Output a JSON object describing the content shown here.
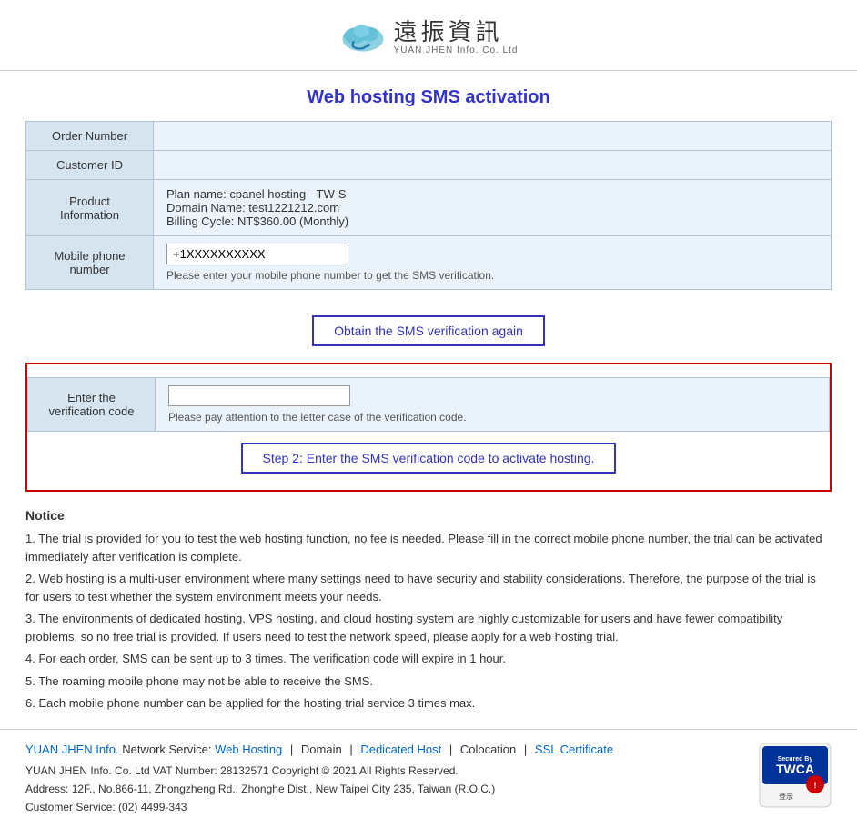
{
  "header": {
    "logo_chinese": "遠振資訊",
    "logo_english": "YUAN JHEN Info. Co. Ltd"
  },
  "page_title": "Web hosting SMS activation",
  "form": {
    "order_number_label": "Order Number",
    "customer_id_label": "Customer ID",
    "product_info_label": "Product Information",
    "product_info_line1": "Plan name: cpanel hosting - TW-S",
    "product_info_line2": "Domain Name: test1221212.com",
    "product_info_line3": "Billing Cycle: NT$360.00 (Monthly)",
    "mobile_label": "Mobile phone number",
    "mobile_value": "+1XXXXXXXXXX",
    "mobile_hint": "Please enter your mobile phone number to get the SMS verification.",
    "sms_button": "Obtain the SMS verification again",
    "verify_label": "Enter the verification code",
    "verify_placeholder": "",
    "verify_hint": "Please pay attention to the letter case of the verification code.",
    "step2_button": "Step 2: Enter the SMS verification code to activate hosting."
  },
  "notice": {
    "title": "Notice",
    "items": [
      "The trial is provided for you to test the web hosting function, no fee is needed. Please fill in the correct mobile phone number, the trial can be activated immediately after verification is complete.",
      "Web hosting is a multi-user environment where many settings need to have security and stability considerations. Therefore, the purpose of the trial is for users to test whether the system environment meets your needs.",
      "The environments of dedicated hosting, VPS hosting, and cloud hosting system are highly customizable for users and have fewer compatibility problems, so no free trial is provided. If users need to test the network speed, please apply for a web hosting trial.",
      "For each order, SMS can be sent up to 3 times. The verification code will expire in 1 hour.",
      "The roaming mobile phone may not be able to receive the SMS.",
      "Each mobile phone number can be applied for the hosting trial service 3 times max."
    ]
  },
  "footer": {
    "brand": "YUAN JHEN Info.",
    "network_service_label": "Network Service:",
    "links": [
      {
        "label": "Web Hosting",
        "color": "#0066cc"
      },
      {
        "label": "Domain",
        "color": "#333"
      },
      {
        "label": "Dedicated Host",
        "color": "#0066cc"
      },
      {
        "label": "Colocation",
        "color": "#333"
      },
      {
        "label": "SSL Certificate",
        "color": "#0066cc"
      }
    ],
    "line1": "YUAN JHEN Info. Co. Ltd  VAT Number: 28132571  Copyright © 2021 All Rights Reserved.",
    "line2": "Address: 12F., No.866-11, Zhongzheng Rd., Zhonghe Dist., New Taipei City 235, Taiwan (R.O.C.)",
    "line3": "Customer Service: (02) 4499-343"
  }
}
